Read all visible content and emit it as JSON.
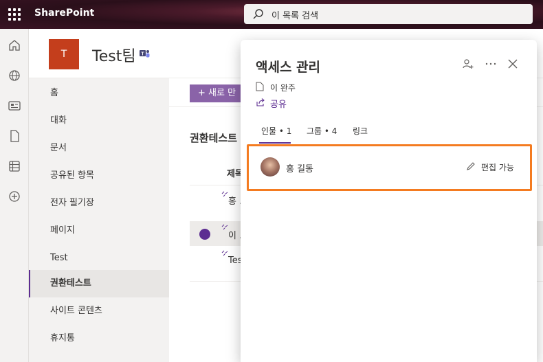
{
  "suite": {
    "brand": "SharePoint",
    "search_placeholder": "이 목록 검색"
  },
  "site": {
    "logo_letter": "T",
    "title": "Test팀"
  },
  "nav": {
    "items": [
      {
        "label": "홈"
      },
      {
        "label": "대화"
      },
      {
        "label": "문서"
      },
      {
        "label": "공유된 항목"
      },
      {
        "label": "전자 필기장"
      },
      {
        "label": "페이지"
      },
      {
        "label": "Test"
      },
      {
        "label": "권환테스트"
      },
      {
        "label": "사이트 콘텐츠"
      },
      {
        "label": "휴지통"
      }
    ],
    "selected": "권환테스트"
  },
  "content": {
    "new_button": "+ 새로 만",
    "list_title": "권환테스트",
    "column_header": "제목",
    "rows": [
      {
        "label": "홍 ..."
      },
      {
        "label": "이 ..."
      },
      {
        "label": "Test"
      }
    ]
  },
  "panel": {
    "title": "액세스 관리",
    "file_name": "이 완주",
    "share_label": "공유",
    "tabs": [
      {
        "label": "인물 • 1"
      },
      {
        "label": "그룹 • 4"
      },
      {
        "label": "링크"
      }
    ],
    "active_tab": "인물 • 1",
    "entries": [
      {
        "name": "홍 길동",
        "permission": "편집 가능"
      }
    ]
  },
  "colors": {
    "accent": "#5c2d91",
    "highlight": "#f47b20",
    "logo": "#c43e1c"
  },
  "icons": [
    "waffle-icon",
    "search-icon",
    "home-icon",
    "globe-icon",
    "news-icon",
    "file-icon",
    "list-icon",
    "add-icon",
    "teams-icon",
    "person-add-icon",
    "more-icon",
    "close-icon",
    "share-icon",
    "pencil-icon"
  ]
}
